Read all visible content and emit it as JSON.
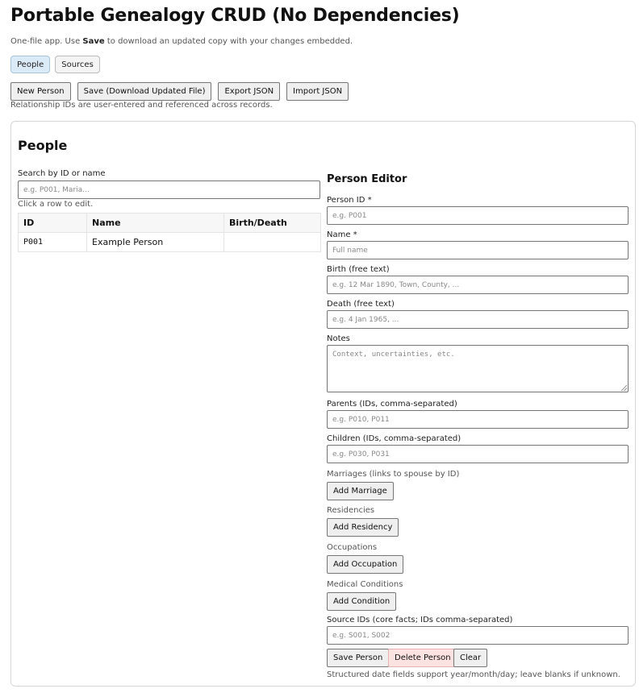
{
  "app": {
    "title": "Portable Genealogy CRUD (No Dependencies)",
    "subtitle_pre": "One-file app. Use ",
    "subtitle_bold": "Save",
    "subtitle_post": " to download an updated copy with your changes embedded."
  },
  "tabs": [
    {
      "label": "People",
      "active": true
    },
    {
      "label": "Sources",
      "active": false
    }
  ],
  "toolbar": {
    "new_person": "New Person",
    "save": "Save (Download Updated File)",
    "export": "Export JSON",
    "import": "Import JSON",
    "hint": "Relationship IDs are user-entered and referenced across records."
  },
  "people": {
    "title": "People",
    "search_label": "Search by ID or name",
    "search_placeholder": "e.g. P001, Maria...",
    "click_hint": "Click a row to edit.",
    "columns": [
      "ID",
      "Name",
      "Birth/Death"
    ],
    "rows": [
      {
        "id": "P001",
        "name": "Example Person",
        "birth_death": ""
      }
    ]
  },
  "editor": {
    "title": "Person Editor",
    "person_id_label": "Person ID *",
    "person_id_placeholder": "e.g. P001",
    "name_label": "Name *",
    "name_placeholder": "Full name",
    "birth_label": "Birth (free text)",
    "birth_placeholder": "e.g. 12 Mar 1890, Town, County, ...",
    "death_label": "Death (free text)",
    "death_placeholder": "e.g. 4 Jan 1965, ...",
    "notes_label": "Notes",
    "notes_placeholder": "Context, uncertainties, etc.",
    "parents_label": "Parents (IDs, comma-separated)",
    "parents_placeholder": "e.g. P010, P011",
    "children_label": "Children (IDs, comma-separated)",
    "children_placeholder": "e.g. P030, P031",
    "marriages_label": "Marriages (links to spouse by ID)",
    "add_marriage": "Add Marriage",
    "residencies_label": "Residencies",
    "add_residency": "Add Residency",
    "occupations_label": "Occupations",
    "add_occupation": "Add Occupation",
    "medical_label": "Medical Conditions",
    "add_condition": "Add Condition",
    "sources_label": "Source IDs (core facts; IDs comma-separated)",
    "sources_placeholder": "e.g. S001, S002",
    "save_person": "Save Person",
    "delete_person": "Delete Person",
    "clear": "Clear",
    "footer_hint": "Structured date fields support year/month/day; leave blanks if unknown."
  }
}
